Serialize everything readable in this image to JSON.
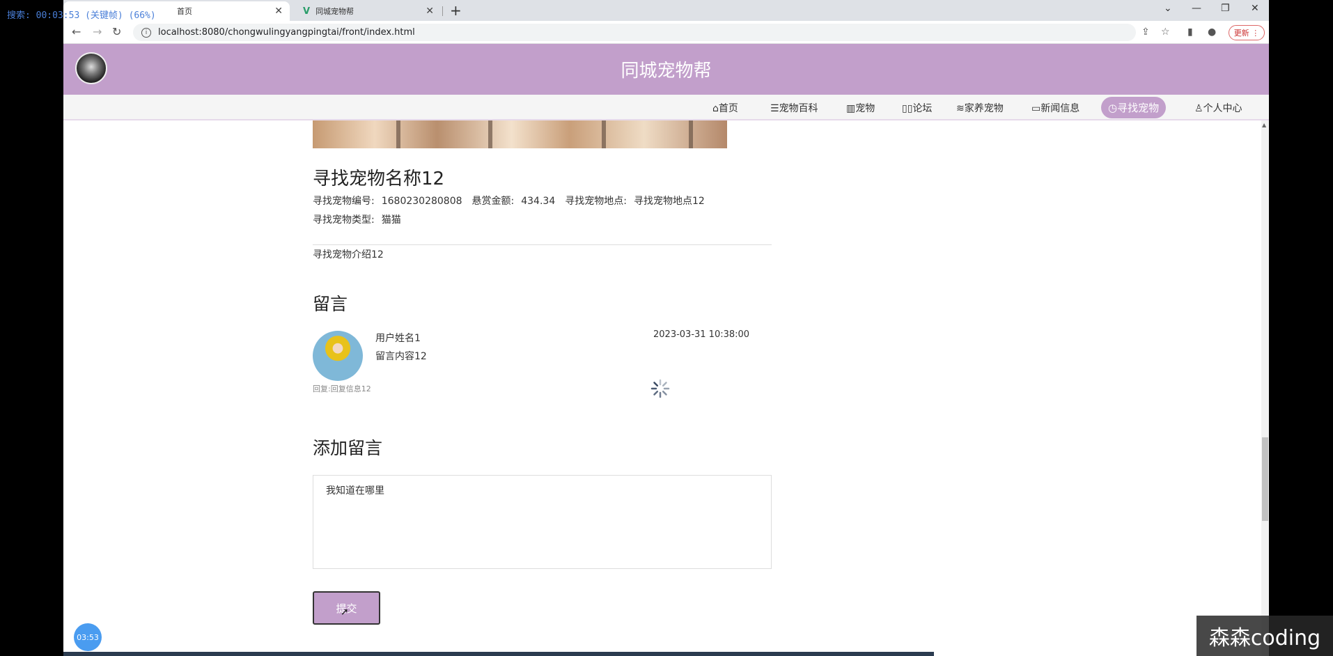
{
  "overlay": {
    "recording_text": "搜索: 00:03:53 (关键帧) (66%)"
  },
  "browser": {
    "tabs": [
      {
        "label": "首页"
      },
      {
        "label": "同城宠物帮"
      }
    ],
    "url": "localhost:8080/chongwulingyangpingtai/front/index.html",
    "update_label": "更新"
  },
  "site": {
    "title": "同城宠物帮",
    "nav": [
      {
        "label": "首页",
        "icon": "home-icon"
      },
      {
        "label": "宠物百科",
        "icon": "sliders-icon"
      },
      {
        "label": "宠物",
        "icon": "grid-icon"
      },
      {
        "label": "论坛",
        "icon": "book-icon"
      },
      {
        "label": "家养宠物",
        "icon": "layers-icon"
      },
      {
        "label": "新闻信息",
        "icon": "open-book-icon"
      },
      {
        "label": "寻找宠物",
        "icon": "clock-icon",
        "active": true
      },
      {
        "label": "个人中心",
        "icon": "user-icon"
      }
    ]
  },
  "detail": {
    "name": "寻找宠物名称12",
    "number_label": "寻找宠物编号:",
    "number_value": "1680230280808",
    "reward_label": "悬赏金额:",
    "reward_value": "434.34",
    "location_label": "寻找宠物地点:",
    "location_value": "寻找宠物地点12",
    "type_label": "寻找宠物类型:",
    "type_value": "猫猫",
    "intro": "寻找宠物介绍12"
  },
  "comments": {
    "section_title": "留言",
    "items": [
      {
        "username": "用户姓名1",
        "content": "留言内容12",
        "date": "2023-03-31 10:38:00",
        "reply": "回复:回复信息12"
      }
    ]
  },
  "add_comment": {
    "section_title": "添加留言",
    "value": "我知道在哪里",
    "submit_label": "提交"
  },
  "timer_badge": "03:53",
  "watermark": "森森coding",
  "colors": {
    "brand": "#c29fcb",
    "badge": "#4a9cf0"
  }
}
